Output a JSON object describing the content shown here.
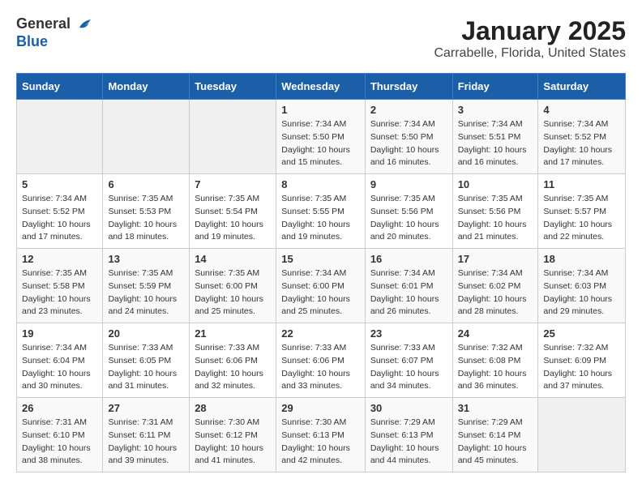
{
  "header": {
    "logo_general": "General",
    "logo_blue": "Blue",
    "title": "January 2025",
    "subtitle": "Carrabelle, Florida, United States"
  },
  "weekdays": [
    "Sunday",
    "Monday",
    "Tuesday",
    "Wednesday",
    "Thursday",
    "Friday",
    "Saturday"
  ],
  "weeks": [
    [
      {
        "day": "",
        "info": ""
      },
      {
        "day": "",
        "info": ""
      },
      {
        "day": "",
        "info": ""
      },
      {
        "day": "1",
        "info": "Sunrise: 7:34 AM\nSunset: 5:50 PM\nDaylight: 10 hours\nand 15 minutes."
      },
      {
        "day": "2",
        "info": "Sunrise: 7:34 AM\nSunset: 5:50 PM\nDaylight: 10 hours\nand 16 minutes."
      },
      {
        "day": "3",
        "info": "Sunrise: 7:34 AM\nSunset: 5:51 PM\nDaylight: 10 hours\nand 16 minutes."
      },
      {
        "day": "4",
        "info": "Sunrise: 7:34 AM\nSunset: 5:52 PM\nDaylight: 10 hours\nand 17 minutes."
      }
    ],
    [
      {
        "day": "5",
        "info": "Sunrise: 7:34 AM\nSunset: 5:52 PM\nDaylight: 10 hours\nand 17 minutes."
      },
      {
        "day": "6",
        "info": "Sunrise: 7:35 AM\nSunset: 5:53 PM\nDaylight: 10 hours\nand 18 minutes."
      },
      {
        "day": "7",
        "info": "Sunrise: 7:35 AM\nSunset: 5:54 PM\nDaylight: 10 hours\nand 19 minutes."
      },
      {
        "day": "8",
        "info": "Sunrise: 7:35 AM\nSunset: 5:55 PM\nDaylight: 10 hours\nand 19 minutes."
      },
      {
        "day": "9",
        "info": "Sunrise: 7:35 AM\nSunset: 5:56 PM\nDaylight: 10 hours\nand 20 minutes."
      },
      {
        "day": "10",
        "info": "Sunrise: 7:35 AM\nSunset: 5:56 PM\nDaylight: 10 hours\nand 21 minutes."
      },
      {
        "day": "11",
        "info": "Sunrise: 7:35 AM\nSunset: 5:57 PM\nDaylight: 10 hours\nand 22 minutes."
      }
    ],
    [
      {
        "day": "12",
        "info": "Sunrise: 7:35 AM\nSunset: 5:58 PM\nDaylight: 10 hours\nand 23 minutes."
      },
      {
        "day": "13",
        "info": "Sunrise: 7:35 AM\nSunset: 5:59 PM\nDaylight: 10 hours\nand 24 minutes."
      },
      {
        "day": "14",
        "info": "Sunrise: 7:35 AM\nSunset: 6:00 PM\nDaylight: 10 hours\nand 25 minutes."
      },
      {
        "day": "15",
        "info": "Sunrise: 7:34 AM\nSunset: 6:00 PM\nDaylight: 10 hours\nand 25 minutes."
      },
      {
        "day": "16",
        "info": "Sunrise: 7:34 AM\nSunset: 6:01 PM\nDaylight: 10 hours\nand 26 minutes."
      },
      {
        "day": "17",
        "info": "Sunrise: 7:34 AM\nSunset: 6:02 PM\nDaylight: 10 hours\nand 28 minutes."
      },
      {
        "day": "18",
        "info": "Sunrise: 7:34 AM\nSunset: 6:03 PM\nDaylight: 10 hours\nand 29 minutes."
      }
    ],
    [
      {
        "day": "19",
        "info": "Sunrise: 7:34 AM\nSunset: 6:04 PM\nDaylight: 10 hours\nand 30 minutes."
      },
      {
        "day": "20",
        "info": "Sunrise: 7:33 AM\nSunset: 6:05 PM\nDaylight: 10 hours\nand 31 minutes."
      },
      {
        "day": "21",
        "info": "Sunrise: 7:33 AM\nSunset: 6:06 PM\nDaylight: 10 hours\nand 32 minutes."
      },
      {
        "day": "22",
        "info": "Sunrise: 7:33 AM\nSunset: 6:06 PM\nDaylight: 10 hours\nand 33 minutes."
      },
      {
        "day": "23",
        "info": "Sunrise: 7:33 AM\nSunset: 6:07 PM\nDaylight: 10 hours\nand 34 minutes."
      },
      {
        "day": "24",
        "info": "Sunrise: 7:32 AM\nSunset: 6:08 PM\nDaylight: 10 hours\nand 36 minutes."
      },
      {
        "day": "25",
        "info": "Sunrise: 7:32 AM\nSunset: 6:09 PM\nDaylight: 10 hours\nand 37 minutes."
      }
    ],
    [
      {
        "day": "26",
        "info": "Sunrise: 7:31 AM\nSunset: 6:10 PM\nDaylight: 10 hours\nand 38 minutes."
      },
      {
        "day": "27",
        "info": "Sunrise: 7:31 AM\nSunset: 6:11 PM\nDaylight: 10 hours\nand 39 minutes."
      },
      {
        "day": "28",
        "info": "Sunrise: 7:30 AM\nSunset: 6:12 PM\nDaylight: 10 hours\nand 41 minutes."
      },
      {
        "day": "29",
        "info": "Sunrise: 7:30 AM\nSunset: 6:13 PM\nDaylight: 10 hours\nand 42 minutes."
      },
      {
        "day": "30",
        "info": "Sunrise: 7:29 AM\nSunset: 6:13 PM\nDaylight: 10 hours\nand 44 minutes."
      },
      {
        "day": "31",
        "info": "Sunrise: 7:29 AM\nSunset: 6:14 PM\nDaylight: 10 hours\nand 45 minutes."
      },
      {
        "day": "",
        "info": ""
      }
    ]
  ]
}
